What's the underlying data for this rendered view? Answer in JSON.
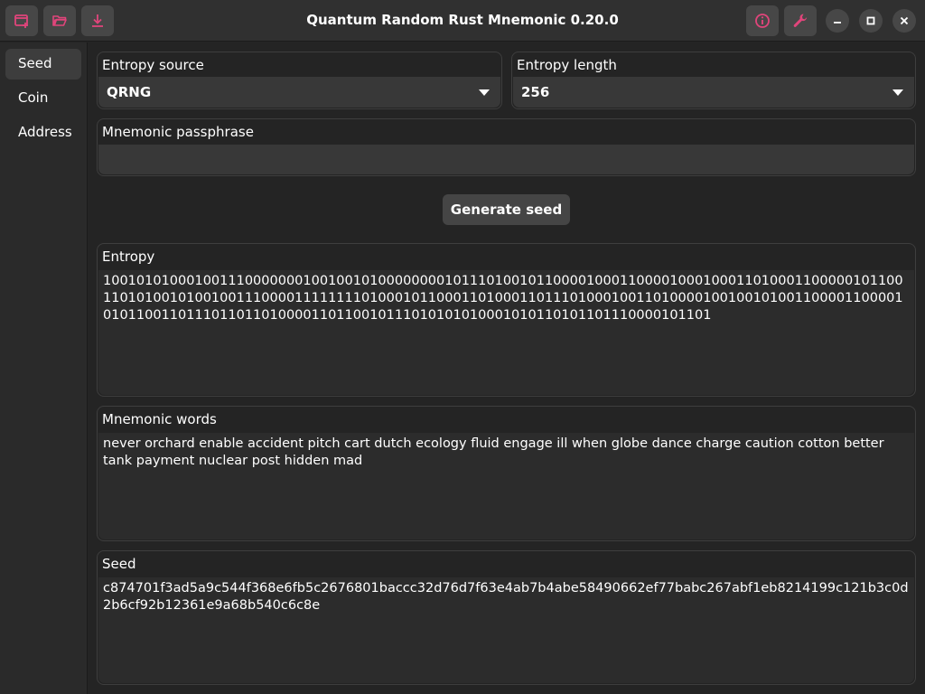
{
  "window": {
    "title": "Quantum Random Rust Mnemonic 0.20.0"
  },
  "header": {
    "left_buttons": [
      "new-window-icon",
      "folder-open-icon",
      "download-icon"
    ],
    "right_buttons": [
      "info-icon",
      "wrench-icon"
    ],
    "window_controls": [
      "minimize-icon",
      "maximize-icon",
      "close-icon"
    ],
    "accent_color": "#e0457b"
  },
  "sidebar": {
    "items": [
      {
        "label": "Seed",
        "active": true
      },
      {
        "label": "Coin",
        "active": false
      },
      {
        "label": "Address",
        "active": false
      }
    ]
  },
  "entropy_source": {
    "label": "Entropy source",
    "value": "QRNG"
  },
  "entropy_length": {
    "label": "Entropy length",
    "value": "256"
  },
  "passphrase": {
    "label": "Mnemonic passphrase",
    "value": "",
    "placeholder": ""
  },
  "generate_button": {
    "label": "Generate seed"
  },
  "entropy": {
    "label": "Entropy",
    "value": "1001010100010011100000001001001010000000010111010010110000100011000010001000110100011000001011001101010010100100111000011111111010001011000110100011011101000100110100001001001010011000011000010101100110111011011010000110110010111010101010001010110101101110000101101"
  },
  "mnemonic": {
    "label": "Mnemonic words",
    "value": "never orchard enable accident pitch cart dutch ecology fluid engage ill when globe dance charge caution cotton better tank payment nuclear post hidden mad"
  },
  "seed": {
    "label": "Seed",
    "value": "c874701f3ad5a9c544f368e6fb5c2676801baccc32d76d7f63e4ab7b4abe58490662ef77babc267abf1eb8214199c121b3c0d2b6cf92b12361e9a68b540c6c8e"
  }
}
